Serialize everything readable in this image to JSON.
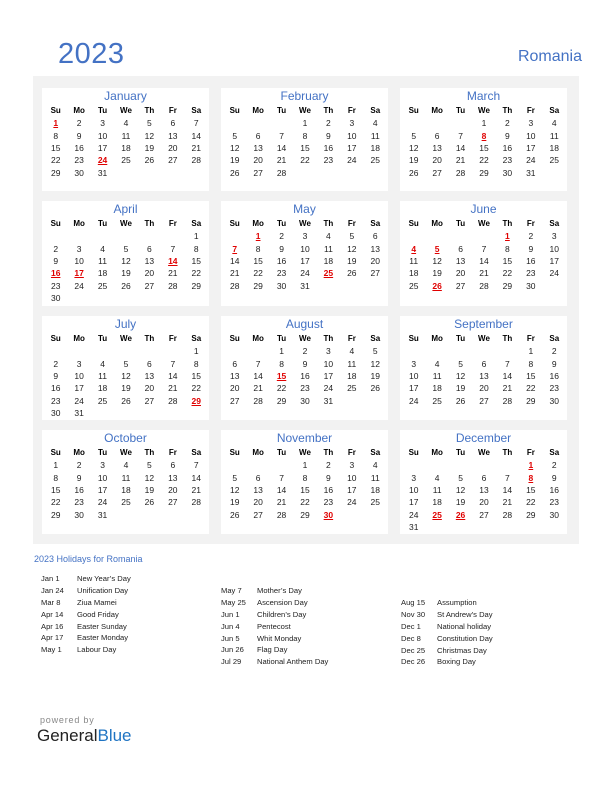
{
  "header": {
    "year": "2023",
    "country": "Romania"
  },
  "weekdays": [
    "Su",
    "Mo",
    "Tu",
    "We",
    "Th",
    "Fr",
    "Sa"
  ],
  "accent_color": "#4472c4",
  "holiday_color": "#e00000",
  "months": [
    {
      "name": "January",
      "start": 0,
      "days": 31,
      "holidays": [
        1,
        24
      ]
    },
    {
      "name": "February",
      "start": 3,
      "days": 28,
      "holidays": []
    },
    {
      "name": "March",
      "start": 3,
      "days": 31,
      "holidays": [
        8
      ]
    },
    {
      "name": "April",
      "start": 6,
      "days": 30,
      "holidays": [
        14,
        16,
        17
      ]
    },
    {
      "name": "May",
      "start": 1,
      "days": 31,
      "holidays": [
        1,
        7,
        25
      ]
    },
    {
      "name": "June",
      "start": 4,
      "days": 30,
      "holidays": [
        1,
        4,
        5,
        26
      ]
    },
    {
      "name": "July",
      "start": 6,
      "days": 31,
      "holidays": [
        29
      ]
    },
    {
      "name": "August",
      "start": 2,
      "days": 31,
      "holidays": [
        15
      ]
    },
    {
      "name": "September",
      "start": 5,
      "days": 30,
      "holidays": []
    },
    {
      "name": "October",
      "start": 0,
      "days": 31,
      "holidays": []
    },
    {
      "name": "November",
      "start": 3,
      "days": 30,
      "holidays": [
        30
      ]
    },
    {
      "name": "December",
      "start": 5,
      "days": 31,
      "holidays": [
        1,
        8,
        25,
        26
      ]
    }
  ],
  "holidays_section": {
    "title": "2023 Holidays for Romania",
    "columns": [
      [
        {
          "date": "Jan 1",
          "name": "New Year’s Day"
        },
        {
          "date": "Jan 24",
          "name": "Unification Day"
        },
        {
          "date": "Mar 8",
          "name": "Ziua Mamei"
        },
        {
          "date": "Apr 14",
          "name": "Good Friday"
        },
        {
          "date": "Apr 16",
          "name": "Easter Sunday"
        },
        {
          "date": "Apr 17",
          "name": "Easter Monday"
        },
        {
          "date": "May 1",
          "name": "Labour Day"
        }
      ],
      [
        {
          "date": "May 7",
          "name": "Mother’s Day"
        },
        {
          "date": "May 25",
          "name": "Ascension Day"
        },
        {
          "date": "Jun 1",
          "name": "Children’s Day"
        },
        {
          "date": "Jun 4",
          "name": "Pentecost"
        },
        {
          "date": "Jun 5",
          "name": "Whit Monday"
        },
        {
          "date": "Jun 26",
          "name": "Flag Day"
        },
        {
          "date": "Jul 29",
          "name": "National Anthem Day"
        }
      ],
      [
        {
          "date": "Aug 15",
          "name": "Assumption"
        },
        {
          "date": "Nov 30",
          "name": "St Andrew’s Day"
        },
        {
          "date": "Dec 1",
          "name": "National holiday"
        },
        {
          "date": "Dec 8",
          "name": "Constitution Day"
        },
        {
          "date": "Dec 25",
          "name": "Christmas Day"
        },
        {
          "date": "Dec 26",
          "name": "Boxing Day"
        }
      ]
    ]
  },
  "footer": {
    "powered_by": "powered by",
    "brand_part1": "General",
    "brand_part2": "Blue"
  }
}
